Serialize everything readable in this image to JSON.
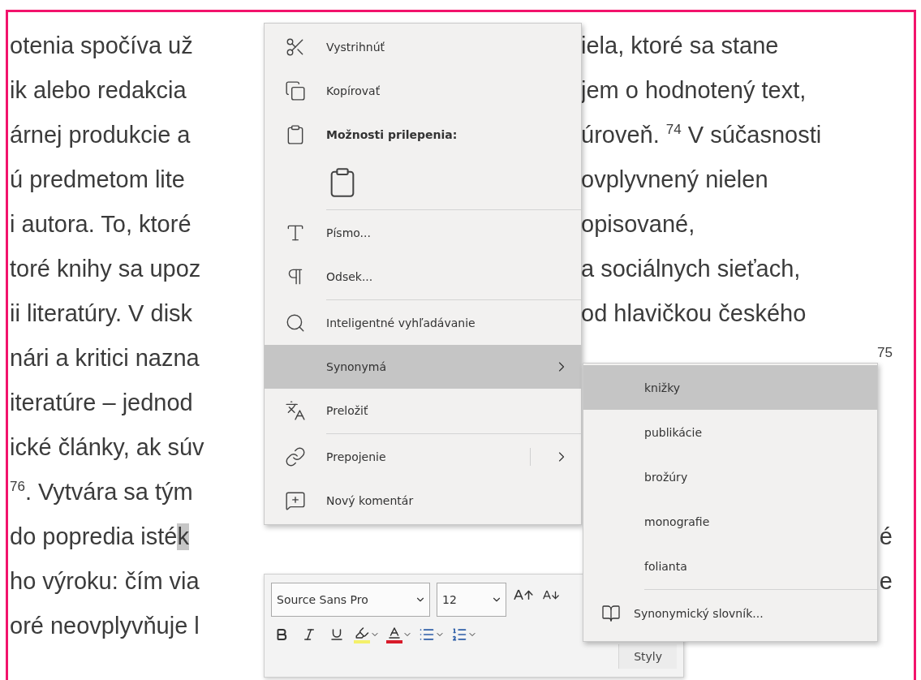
{
  "document": {
    "lines": [
      {
        "left": "otenia spočíva už",
        "right": "iela, ktoré sa stane"
      },
      {
        "left": "ik alebo redakcia",
        "right": "jem o hodnotený text,"
      },
      {
        "left": "árnej produkcie a",
        "right": "úroveň. $^{74}$ V súčasnosti"
      },
      {
        "left": "ú predmetom lite",
        "right": "ovplyvnený nielen"
      },
      {
        "left": "i autora. To, ktoré",
        "right": "opisované,"
      },
      {
        "left": "toré knihy sa upoz",
        "right": "a sociálnych sieťach,"
      },
      {
        "left": "ii literatúry. V disk",
        "right": "od hlavičkou českého"
      },
      {
        "left": "nári a kritici nazna",
        "right": "$^{75}$"
      },
      {
        "left": "iteratúre – jednod"
      },
      {
        "left": "ické články, ak súv"
      },
      {
        "left": "$^{76}$. Vytvára sa tým"
      },
      {
        "left": "do popredia isté ",
        "selection": "k",
        "right": "é"
      },
      {
        "left": "ho výroku: čím via",
        "right": "e"
      },
      {
        "left": "oré neovplyvňuje l"
      }
    ]
  },
  "context_menu": {
    "items": [
      {
        "kind": "command",
        "label": "Vystrihnúť",
        "selected": false
      },
      {
        "kind": "command",
        "label": "Kopírovať",
        "selected": false
      },
      {
        "kind": "heading",
        "label": "Možnosti prilepenia:"
      },
      {
        "kind": "paste_options"
      },
      {
        "kind": "separator"
      },
      {
        "kind": "command",
        "label": "Písmo...",
        "selected": false
      },
      {
        "kind": "command",
        "label": "Odsek...",
        "selected": false
      },
      {
        "kind": "separator"
      },
      {
        "kind": "command",
        "label": "Inteligentné vyhľadávanie",
        "selected": false
      },
      {
        "kind": "submenu",
        "label": "Synonymá",
        "selected": true
      },
      {
        "kind": "command",
        "label": "Preložiť",
        "selected": false
      },
      {
        "kind": "separator"
      },
      {
        "kind": "split_submenu",
        "label": "Prepojenie",
        "selected": false
      },
      {
        "kind": "command",
        "label": "Nový komentár",
        "selected": false
      }
    ]
  },
  "synonyms_menu": {
    "items": [
      {
        "label": "knižky",
        "selected": true
      },
      {
        "label": "publikácie",
        "selected": false
      },
      {
        "label": "brožúry",
        "selected": false
      },
      {
        "label": "monografie",
        "selected": false
      },
      {
        "label": "folianta",
        "selected": false
      }
    ],
    "footer": "Synonymický slovník..."
  },
  "mini_toolbar": {
    "font": "Source Sans Pro",
    "size": "12",
    "styles_button": "Styly"
  }
}
